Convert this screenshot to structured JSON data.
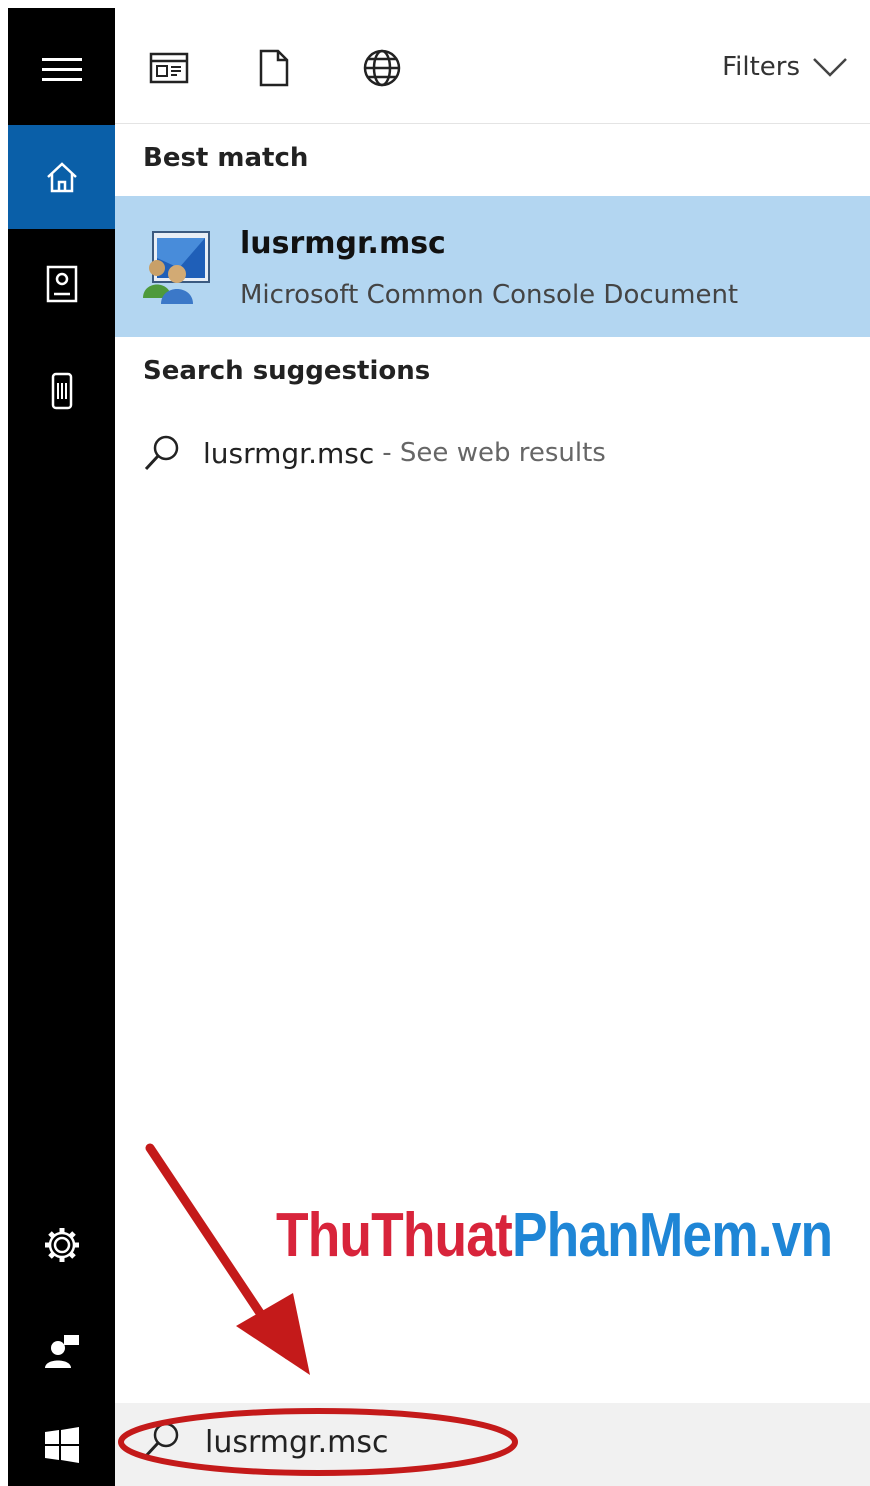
{
  "toolbar": {
    "filters_label": "Filters"
  },
  "best_match": {
    "heading": "Best match",
    "title": "lusrmgr.msc",
    "subtitle": "Microsoft Common Console Document"
  },
  "suggestions": {
    "heading": "Search suggestions",
    "items": [
      {
        "query": "lusrmgr.msc",
        "hint": "- See web results"
      }
    ]
  },
  "search": {
    "value": "lusrmgr.msc"
  },
  "watermark": {
    "part1": "ThuThuat",
    "part2": "PhanMem.vn"
  },
  "colors": {
    "rail": "#000000",
    "rail_active": "#0a5fa8",
    "highlight": "#b3d6f1",
    "annotation": "#c41a1a",
    "watermark_red": "#d8243b",
    "watermark_blue": "#1f86d6"
  },
  "icons": {
    "rail": [
      "hamburger-icon",
      "home-icon",
      "notebook-icon",
      "device-icon",
      "settings-icon",
      "feedback-icon",
      "windows-start-icon"
    ],
    "toolbar": [
      "apps-icon",
      "documents-icon",
      "web-icon",
      "chevron-down-icon"
    ],
    "search": "search-icon"
  }
}
